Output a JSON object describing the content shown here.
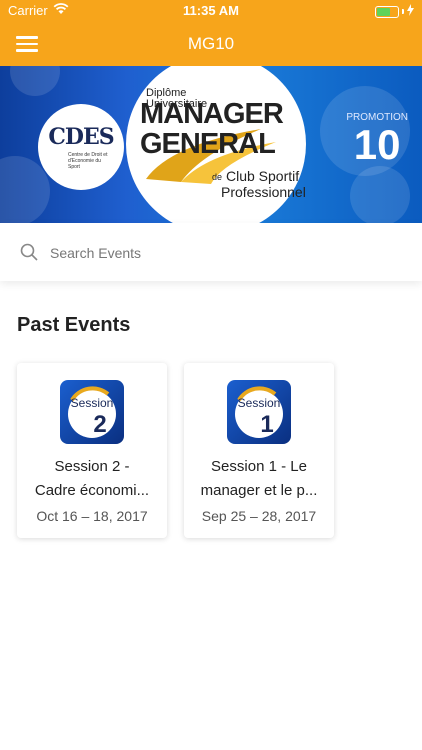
{
  "status_bar": {
    "carrier": "Carrier",
    "time": "11:35 AM",
    "battery_percent": 0.7
  },
  "nav": {
    "title": "MG10"
  },
  "banner": {
    "logo_text": "CDES",
    "logo_subtitle": "Centre de Droit et d'Economie du Sport",
    "diploma_line1": "Diplôme",
    "diploma_line2": "Universitaire",
    "main_line1": "MANAGER",
    "main_line2": "GENERAL",
    "de": "de",
    "club_line1": "Club Sportif",
    "club_line2": "Professionnel",
    "promotion_label": "PROMOTION",
    "promotion_number": "10"
  },
  "search": {
    "placeholder": "Search Events"
  },
  "section": {
    "title": "Past Events"
  },
  "events": [
    {
      "title_line1": "Session 2 -",
      "title_line2": "Cadre économi...",
      "date": "Oct 16 – 18, 2017",
      "icon_word": "Session",
      "icon_number": "2"
    },
    {
      "title_line1": "Session 1 - Le",
      "title_line2": "manager et le p...",
      "date": "Sep 25 – 28, 2017",
      "icon_word": "Session",
      "icon_number": "1"
    }
  ]
}
